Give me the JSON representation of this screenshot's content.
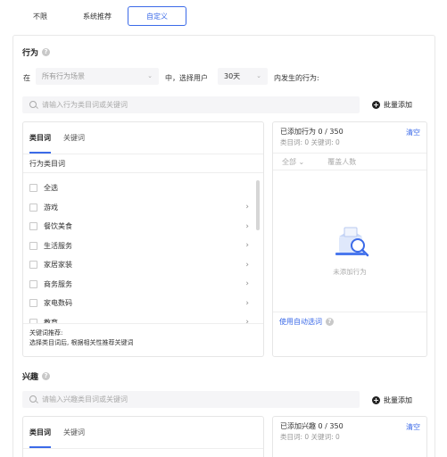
{
  "top_tabs": [
    {
      "label": "不限"
    },
    {
      "label": "系统推荐"
    },
    {
      "label": "自定义"
    }
  ],
  "behavior": {
    "title": "行为",
    "in_label": "在",
    "scene_placeholder": "所有行为场景",
    "mid_label": "中，选择用户",
    "days_value": "30天",
    "suffix_label": "内发生的行为:",
    "search_placeholder": "请输入行为类目词或关键词",
    "bulk_add": "批量添加",
    "tabs": [
      "类目词",
      "关键词"
    ],
    "category_header": "行为类目词",
    "categories": [
      "全选",
      "游戏",
      "餐饮美食",
      "生活服务",
      "家居家装",
      "商务服务",
      "家电数码",
      "教育"
    ],
    "tip_title": "关键词推荐:",
    "tip_text": "选择类目词后, 根据相关性推荐关键词",
    "added_label": "已添加行为",
    "added_count": "0 / 350",
    "clear": "清空",
    "sub_label": "类目词:  0    关键词:  0",
    "filter_all": "全部",
    "filter_cover": "覆盖人数",
    "empty_text": "未添加行为",
    "auto_select": "使用自动选词"
  },
  "interest": {
    "title": "兴趣",
    "search_placeholder": "请输入兴趣类目词或关键词",
    "bulk_add": "批量添加",
    "tabs": [
      "类目词",
      "关键词"
    ],
    "added_label": "已添加兴趣",
    "added_count": "0 / 350",
    "clear": "清空",
    "sub_label": "类目词:  0    关键词:  0"
  },
  "colors": {
    "accent": "#3b6ae8",
    "panel_bg": "#f5f5f7",
    "border": "#e6e6e6"
  },
  "icons": {
    "help": "question-circle-icon",
    "plus": "plus-circle-icon",
    "search": "search-icon",
    "chevron": "chevron-down-icon",
    "arrow": "chevron-right-icon",
    "empty": "empty-box-illustration"
  }
}
